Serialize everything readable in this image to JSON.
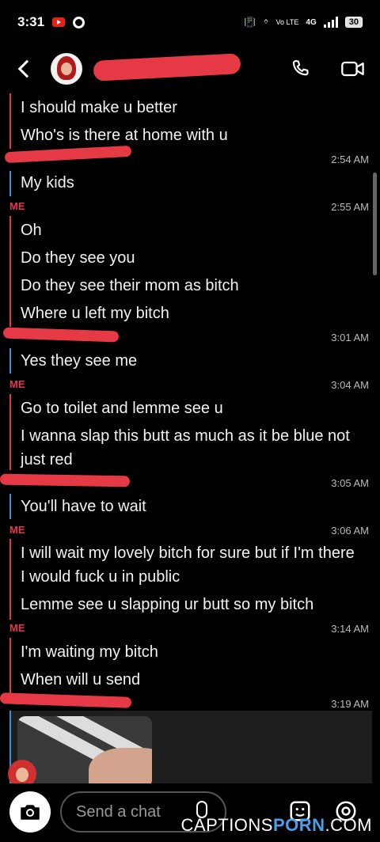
{
  "status_bar": {
    "time": "3:31",
    "network": "4G",
    "volte": "Vo LTE",
    "battery": "30"
  },
  "header": {
    "contact_name": "",
    "back_icon": "chevron-left-icon",
    "call_icon": "phone-icon",
    "video_icon": "video-camera-icon"
  },
  "chat": {
    "me_label": "ME",
    "messages": [
      {
        "text": "I should make u better",
        "sender": "me"
      },
      {
        "text": "Who's is there at home with u",
        "sender": "me"
      },
      {
        "time": "2:54 AM"
      },
      {
        "text": "My kids",
        "sender": "them"
      },
      {
        "time": "2:55 AM"
      },
      {
        "text": "Oh",
        "sender": "me"
      },
      {
        "text": "Do they see you",
        "sender": "me"
      },
      {
        "text": "Do they see their mom as bitch",
        "sender": "me"
      },
      {
        "text": "Where u left my bitch",
        "sender": "me"
      },
      {
        "time": "3:01 AM"
      },
      {
        "text": "Yes they see me",
        "sender": "them"
      },
      {
        "time": "3:04 AM"
      },
      {
        "text": "Go to toilet and lemme see u",
        "sender": "me"
      },
      {
        "text": "I wanna slap this butt as much as it be blue not just red",
        "sender": "me"
      },
      {
        "time": "3:05 AM"
      },
      {
        "text": "You'll have to wait",
        "sender": "them"
      },
      {
        "time": "3:06 AM"
      },
      {
        "text": "I will wait my lovely bitch for sure but if I'm there I would fuck u in public",
        "sender": "me"
      },
      {
        "text": "Lemme see u slapping ur butt so my bitch",
        "sender": "me"
      },
      {
        "time": "3:14 AM"
      },
      {
        "text": "I'm waiting my bitch",
        "sender": "me"
      },
      {
        "text": "When will u send",
        "sender": "me"
      },
      {
        "time": "3:19 AM"
      }
    ]
  },
  "composer": {
    "placeholder": "Send a chat",
    "camera_icon": "camera-icon",
    "mic_icon": "microphone-icon",
    "sticker_icon": "sticker-icon",
    "location_icon": "location-pin-icon"
  },
  "watermark": {
    "prefix": "CAPTIONS",
    "highlight": "PORN",
    "suffix": ".COM"
  },
  "colors": {
    "me_accent": "#e0394a",
    "them_accent": "#3a8fd6",
    "redaction": "#e53a46"
  }
}
